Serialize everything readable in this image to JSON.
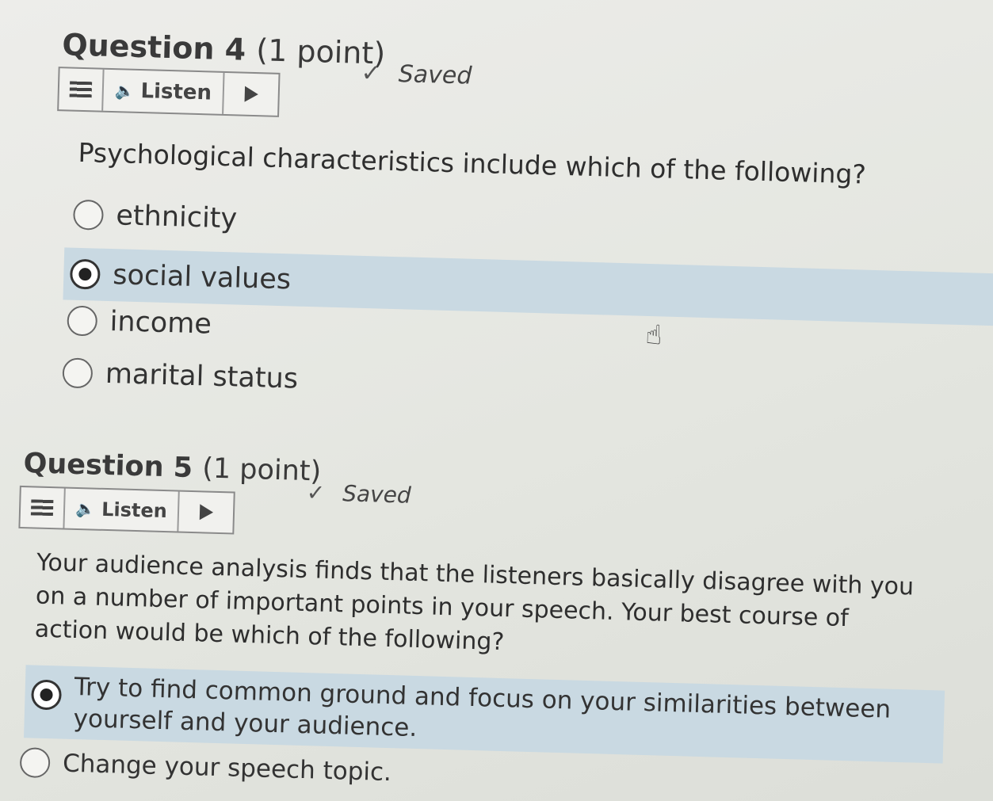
{
  "q4": {
    "title": "Question 4",
    "points": "(1 point)",
    "saved": "Saved",
    "listen": "Listen",
    "question": "Psychological characteristics include which of the following?",
    "options": [
      "ethnicity",
      "social values",
      "income",
      "marital status"
    ]
  },
  "q5": {
    "title": "Question 5",
    "points": "(1 point)",
    "saved": "Saved",
    "listen": "Listen",
    "question": "Your audience analysis finds that the listeners basically disagree with you on a number of important points in your speech. Your best course of action would be which of the following?",
    "options": [
      "Try to find common ground and focus on your similarities between yourself and your audience.",
      "Change your speech topic."
    ]
  },
  "colors": {
    "selected_band": "#c9d9e2",
    "background": "#e6e7e1"
  },
  "icons": {
    "check": "check-icon",
    "menu": "menu-icon",
    "speaker": "speaker-icon",
    "play": "play-icon",
    "cursor": "hand-cursor-icon"
  }
}
